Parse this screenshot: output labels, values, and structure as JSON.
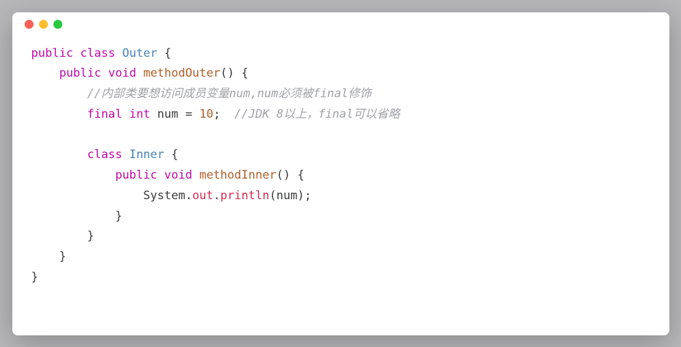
{
  "titlebar": {
    "buttons": [
      "close",
      "minimize",
      "zoom"
    ]
  },
  "code": {
    "lines": [
      {
        "indent": 0,
        "tokens": [
          {
            "t": "public",
            "c": "kw"
          },
          {
            "t": " ",
            "c": ""
          },
          {
            "t": "class",
            "c": "kw"
          },
          {
            "t": " ",
            "c": ""
          },
          {
            "t": "Outer",
            "c": "classname"
          },
          {
            "t": " {",
            "c": "punct"
          }
        ]
      },
      {
        "indent": 1,
        "tokens": [
          {
            "t": "public",
            "c": "kw"
          },
          {
            "t": " ",
            "c": ""
          },
          {
            "t": "void",
            "c": "type"
          },
          {
            "t": " ",
            "c": ""
          },
          {
            "t": "methodOuter",
            "c": "method"
          },
          {
            "t": "() {",
            "c": "punct"
          }
        ]
      },
      {
        "indent": 2,
        "tokens": [
          {
            "t": "//内部类要想访问成员变量num,num必须被final修饰",
            "c": "comment"
          }
        ]
      },
      {
        "indent": 2,
        "tokens": [
          {
            "t": "final",
            "c": "kw"
          },
          {
            "t": " ",
            "c": ""
          },
          {
            "t": "int",
            "c": "type"
          },
          {
            "t": " num = ",
            "c": "ident"
          },
          {
            "t": "10",
            "c": "num"
          },
          {
            "t": ";  ",
            "c": "punct"
          },
          {
            "t": "//JDK 8以上，final可以省略",
            "c": "comment"
          }
        ]
      },
      {
        "indent": 0,
        "tokens": []
      },
      {
        "indent": 2,
        "tokens": [
          {
            "t": "class",
            "c": "kw"
          },
          {
            "t": " ",
            "c": ""
          },
          {
            "t": "Inner",
            "c": "classname"
          },
          {
            "t": " {",
            "c": "punct"
          }
        ]
      },
      {
        "indent": 3,
        "tokens": [
          {
            "t": "public",
            "c": "kw"
          },
          {
            "t": " ",
            "c": ""
          },
          {
            "t": "void",
            "c": "type"
          },
          {
            "t": " ",
            "c": ""
          },
          {
            "t": "methodInner",
            "c": "method"
          },
          {
            "t": "() {",
            "c": "punct"
          }
        ]
      },
      {
        "indent": 4,
        "tokens": [
          {
            "t": "System",
            "c": "ident"
          },
          {
            "t": ".",
            "c": "punct"
          },
          {
            "t": "out",
            "c": "obj"
          },
          {
            "t": ".",
            "c": "punct"
          },
          {
            "t": "println",
            "c": "member"
          },
          {
            "t": "(num);",
            "c": "punct"
          }
        ]
      },
      {
        "indent": 3,
        "tokens": [
          {
            "t": "}",
            "c": "punct"
          }
        ]
      },
      {
        "indent": 2,
        "tokens": [
          {
            "t": "}",
            "c": "punct"
          }
        ]
      },
      {
        "indent": 1,
        "tokens": [
          {
            "t": "}",
            "c": "punct"
          }
        ]
      },
      {
        "indent": 0,
        "tokens": [
          {
            "t": "}",
            "c": "punct"
          }
        ]
      }
    ],
    "indentUnit": "    "
  }
}
